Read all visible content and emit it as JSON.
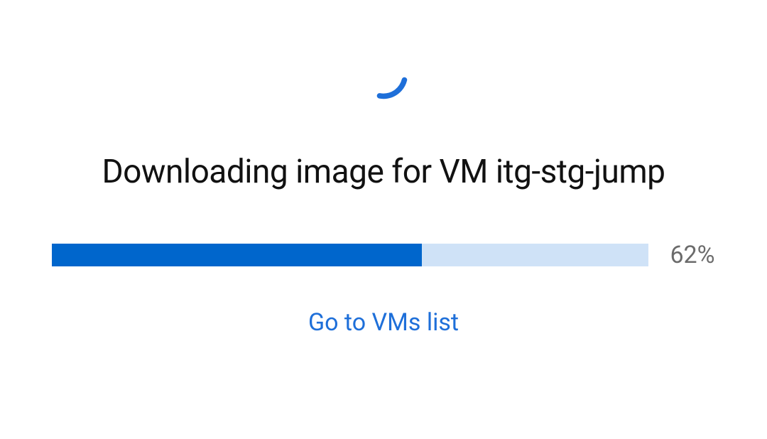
{
  "status": {
    "title": "Downloading image for VM itg-stg-jump"
  },
  "progress": {
    "percent": 62,
    "label": "62%"
  },
  "actions": {
    "go_to_list": "Go to VMs list"
  },
  "colors": {
    "accent": "#0066cc",
    "progress_track": "#cfe2f7",
    "link": "#1e6fd9"
  }
}
